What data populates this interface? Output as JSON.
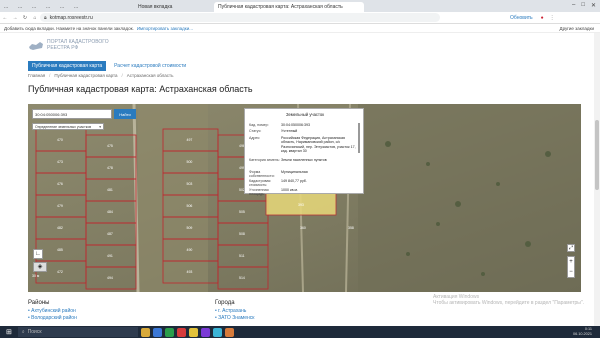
{
  "browser": {
    "tabs": [
      {
        "label": "..."
      },
      {
        "label": "..."
      },
      {
        "label": "..."
      },
      {
        "label": "..."
      },
      {
        "label": "..."
      },
      {
        "label": "..."
      },
      {
        "label": "Новая вкладка"
      },
      {
        "label": "Публичная кадастровая карта: Астраханская область"
      }
    ],
    "url": "kotmap.rosreestr.ru",
    "profile_label": "Обновить",
    "bookmarks_text": "Добавить сюда вкладки. Нажмите на значок панели закладок.",
    "bookmarks_link": "Импортировать закладки...",
    "other_bookmarks": "Другие закладки"
  },
  "site": {
    "logo_line1": "ПОРТАЛ КАДАСТРОВОГО",
    "logo_line2": "РЕЕСТРА РФ",
    "tab_public_map": "Публичная кадастровая карта",
    "tab_cost": "Расчет кадастровой стоимости",
    "breadcrumbs": [
      "Главная",
      "Публичная кадастровая карта",
      "Астраханская область"
    ],
    "page_title": "Публичная кадастровая карта: Астраханская область"
  },
  "map": {
    "search_value": "30:04:050006:393",
    "search_button": "Найти",
    "layer_select": "Определение земельных участков",
    "scale_text": "30 м",
    "parcel_numbers": [
      "470",
      "473",
      "476",
      "479",
      "482",
      "485",
      "472",
      "475",
      "478",
      "481",
      "484",
      "487",
      "491",
      "494",
      "497",
      "500",
      "503",
      "506",
      "509",
      "490",
      "493",
      "496",
      "499",
      "502",
      "505",
      "508",
      "511",
      "514",
      "517",
      "520",
      "393",
      "360",
      "358"
    ]
  },
  "popup": {
    "title": "Земельный участок",
    "rows": [
      {
        "label": "Кад. номер:",
        "value": "30:04:050006:393"
      },
      {
        "label": "Статус:",
        "value": "Учтенный"
      },
      {
        "label": "Адрес:",
        "value": "Российская Федерация, Астраханская область, Наримановский район, с/с Разночинский, пер. Энтузиастов, участок 17, кад. квартал 30"
      },
      {
        "label": "Категория земель:",
        "value": "Земли населенных пунктов"
      },
      {
        "label": "Форма собственности:",
        "value": "Муниципальная"
      },
      {
        "label": "Кадастровая стоимость:",
        "value": "149 840,77 руб."
      },
      {
        "label": "Уточненная площадь:",
        "value": "1000 кв.м."
      }
    ]
  },
  "watermark": {
    "line1": "Активация Windows",
    "line2": "Чтобы активировать Windows, перейдите в раздел \"Параметры\"."
  },
  "regions": {
    "heading": "Районы",
    "items": [
      "Ахтубинский район",
      "Володарский район",
      "Енотаевский район"
    ]
  },
  "cities": {
    "heading": "Города",
    "items": [
      "г. Астрахань",
      "ЗАТО Знаменск"
    ]
  },
  "taskbar": {
    "search_placeholder": "Поиск",
    "time": "0:11",
    "date": "06.10.2021"
  },
  "colors": {
    "accent": "#2a7bbf",
    "parcel_outline": "#c0262d",
    "highlight_parcel": "#e8d97a"
  }
}
